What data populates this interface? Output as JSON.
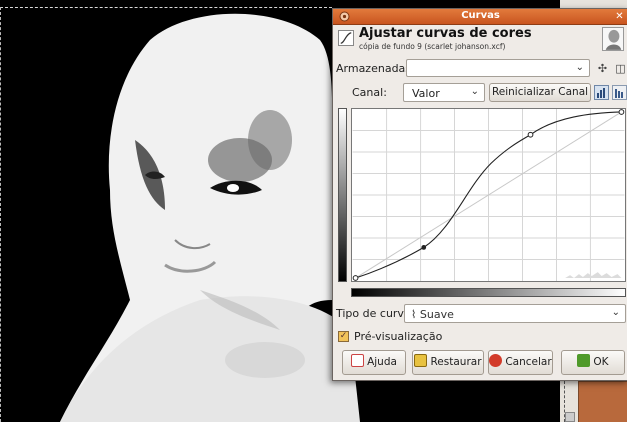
{
  "dialog": {
    "window_title": "Curvas",
    "header_title": "Ajustar curvas de cores",
    "header_subtitle": "cópia de fundo 9 (scarlet johanson.xcf)"
  },
  "presets": {
    "label": "Armazenadas:",
    "value": ""
  },
  "channel": {
    "label": "Canal:",
    "value": "Valor",
    "reset_label": "Reinicializar Canal"
  },
  "curve_type": {
    "label": "Tipo de curva:",
    "value": "Suave"
  },
  "preview": {
    "label": "Pré-visualização",
    "checked": true
  },
  "buttons": {
    "help": "Ajuda",
    "restore": "Restaurar",
    "cancel": "Cancelar",
    "ok": "OK"
  },
  "colors": {
    "titlebar": "#d9662b",
    "dialog_bg": "#efebe7",
    "canvas_bg": "#000000",
    "swatch": "#b8693c"
  }
}
